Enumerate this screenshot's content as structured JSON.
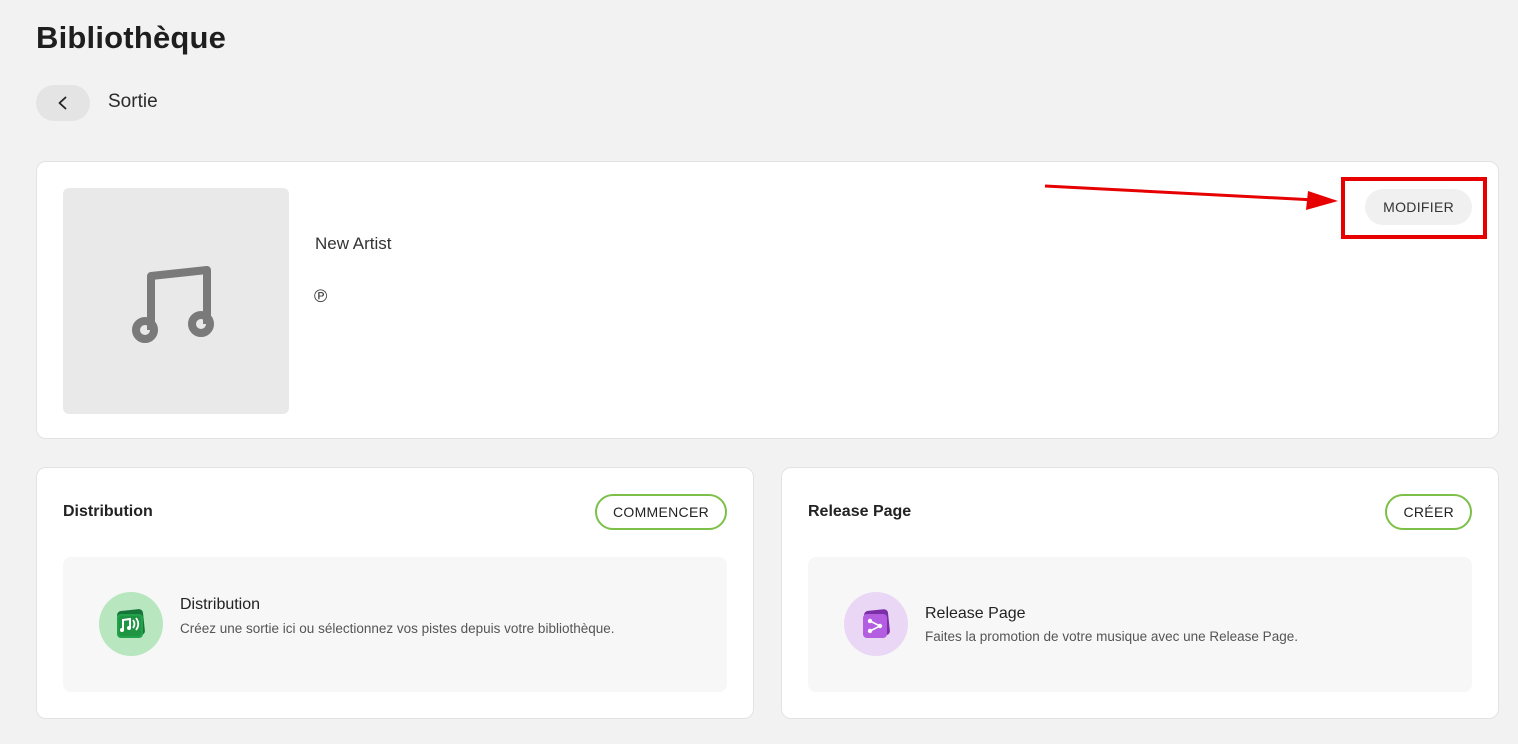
{
  "header": {
    "title": "Bibliothèque"
  },
  "breadcrumb": {
    "back_icon": "chevron-left-icon",
    "label": "Sortie"
  },
  "release": {
    "cover_icon": "music-note-icon",
    "artist": "New Artist",
    "phonogram_symbol": "℗",
    "edit_label": "MODIFIER"
  },
  "annotation": {
    "color": "#e60000"
  },
  "distribution": {
    "title": "Distribution",
    "action_label": "COMMENCER",
    "feature_title": "Distribution",
    "feature_desc": "Créez une sortie ici ou sélectionnez vos pistes depuis votre bibliothèque.",
    "icon": "distribution-icon",
    "accent": "#7cc04a"
  },
  "release_page": {
    "title": "Release Page",
    "action_label": "CRÉER",
    "feature_title": "Release Page",
    "feature_desc": "Faites la promotion de votre musique avec une Release Page.",
    "icon": "share-icon",
    "accent": "#7cc04a"
  }
}
